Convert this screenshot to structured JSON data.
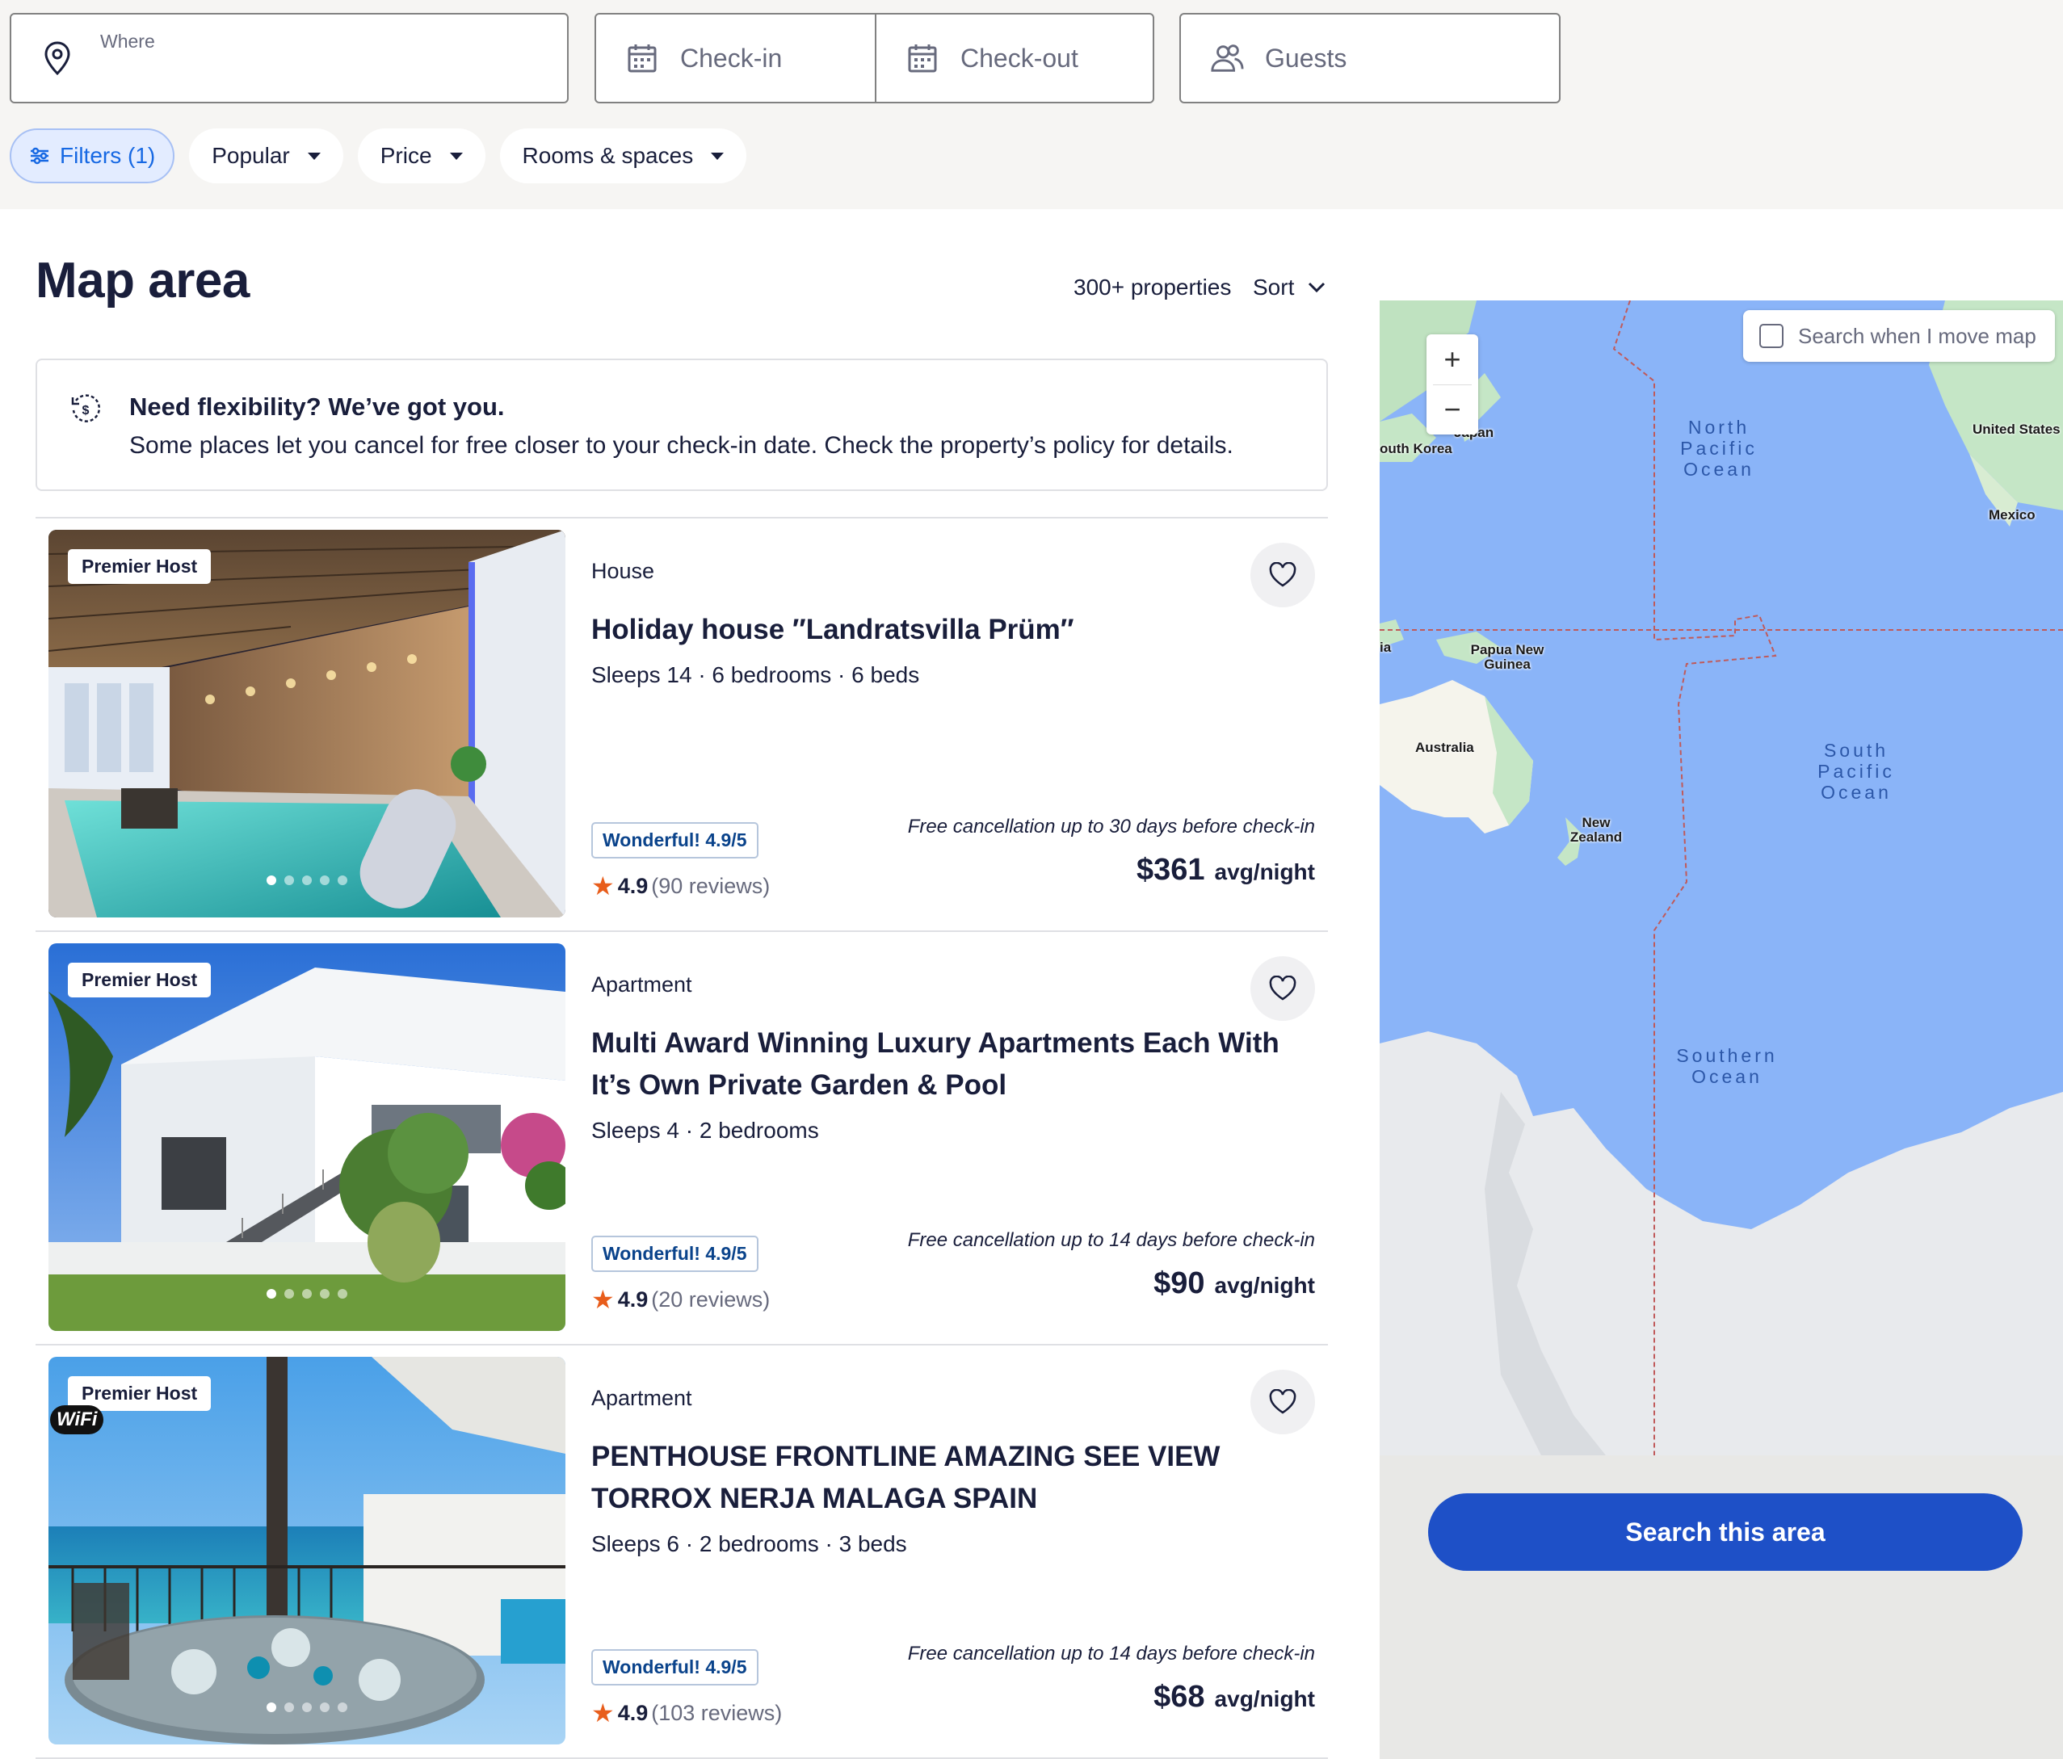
{
  "search": {
    "where_label": "Where",
    "checkin": "Check-in",
    "checkout": "Check-out",
    "guests": "Guests"
  },
  "filters": {
    "filters_label": "Filters (1)",
    "popular": "Popular",
    "price": "Price",
    "rooms": "Rooms & spaces"
  },
  "header": {
    "title": "Map area",
    "count": "300+ properties",
    "sort": "Sort"
  },
  "banner": {
    "title": "Need flexibility? We’ve got you.",
    "body": "Some places let you cancel for free closer to your check-in date. Check the property’s policy for details."
  },
  "listings": [
    {
      "badge": "Premier Host",
      "type": "House",
      "name": "Holiday house ″Landratsvilla Prüm″",
      "details": "Sleeps 14 · 6 bedrooms · 6 beds",
      "rating_badge": "Wonderful! 4.9/5",
      "rating": "4.9",
      "reviews": "(90 reviews)",
      "cancellation": "Free cancellation up to 30 days before check-in",
      "price": "$361",
      "per": "avg/night"
    },
    {
      "badge": "Premier Host",
      "type": "Apartment",
      "name": "Multi Award Winning Luxury Apartments Each With It’s Own Private Garden & Pool",
      "details": "Sleeps 4 · 2 bedrooms",
      "rating_badge": "Wonderful! 4.9/5",
      "rating": "4.9",
      "reviews": "(20 reviews)",
      "cancellation": "Free cancellation up to 14 days before check-in",
      "price": "$90",
      "per": "avg/night"
    },
    {
      "badge": "Premier Host",
      "type": "Apartment",
      "name": "PENTHOUSE FRONTLINE AMAZING SEE VIEW TORROX NERJA MALAGA SPAIN",
      "details": "Sleeps 6 · 2 bedrooms · 3 beds",
      "rating_badge": "Wonderful! 4.9/5",
      "rating": "4.9",
      "reviews": "(103 reviews)",
      "cancellation": "Free cancellation up to 14 days before check-in",
      "price": "$68",
      "per": "avg/night"
    }
  ],
  "map": {
    "move_map": "Search when I move map",
    "zoom_in": "+",
    "zoom_out": "−",
    "labels": {
      "south_korea": "outh Korea",
      "japan": "Japan",
      "united_states": "United States",
      "mexico": "Mexico",
      "ia": "ia",
      "png": "Papua New Guinea",
      "australia": "Australia",
      "nz": "New Zealand",
      "north_pacific": "North Pacific Ocean",
      "south_pacific": "South Pacific Ocean",
      "southern": "Southern Ocean"
    },
    "search_button": "Search this area"
  },
  "colors": {
    "accent": "#1668e3",
    "brand_button": "#1e50c7",
    "ocean": "#8ab4f8",
    "star": "#e85d1b"
  }
}
